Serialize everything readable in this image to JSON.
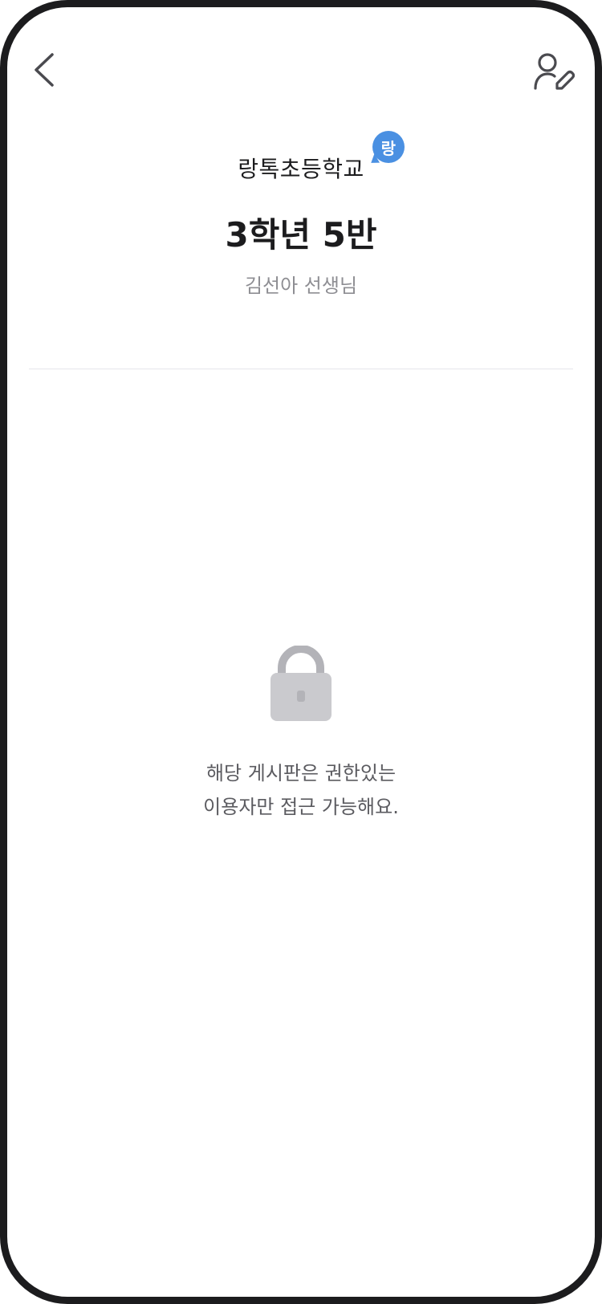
{
  "header": {
    "back_icon": "chevron-left-icon",
    "profile_edit_icon": "user-edit-icon"
  },
  "school": {
    "name": "랑톡초등학교",
    "badge": "랑",
    "badge_color": "#4a90e2"
  },
  "class_info": {
    "title": "3학년 5반",
    "teacher": "김선아 선생님"
  },
  "locked": {
    "icon": "lock-icon",
    "line1": "해당 게시판은 권한있는",
    "line2": "이용자만 접근 가능해요."
  }
}
